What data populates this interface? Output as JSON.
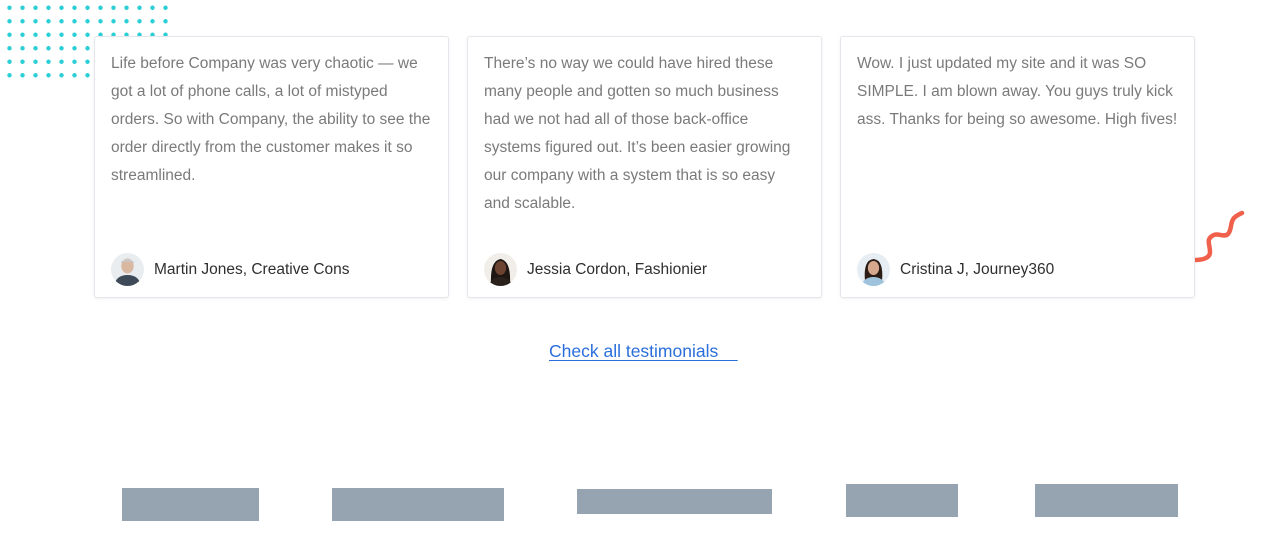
{
  "testimonials": [
    {
      "quote": "Life before Company was very chaotic — we got a lot of phone calls, a lot of mistyped orders. So with Company, the ability to see the order directly from the customer makes it so streamlined.",
      "author": "Martin Jones, Creative Cons"
    },
    {
      "quote": "There’s no way we could have hired these many people and gotten so much business had we not had all of those back-office systems figured out. It’s been easier growing our company with a system that is so easy and scalable.",
      "author": "Jessia Cordon, Fashionier"
    },
    {
      "quote": "Wow. I just updated my site and it was SO SIMPLE. I am blown away. You guys truly kick ass. Thanks for being so awesome. High fives!",
      "author": "Cristina J, Journey360"
    }
  ],
  "cta": {
    "label": "Check all testimonials    "
  },
  "colors": {
    "dots": "#2ccfd6",
    "squiggle": "#f0604a",
    "link": "#2a6fdb",
    "logo_placeholder": "#96a3b0"
  }
}
